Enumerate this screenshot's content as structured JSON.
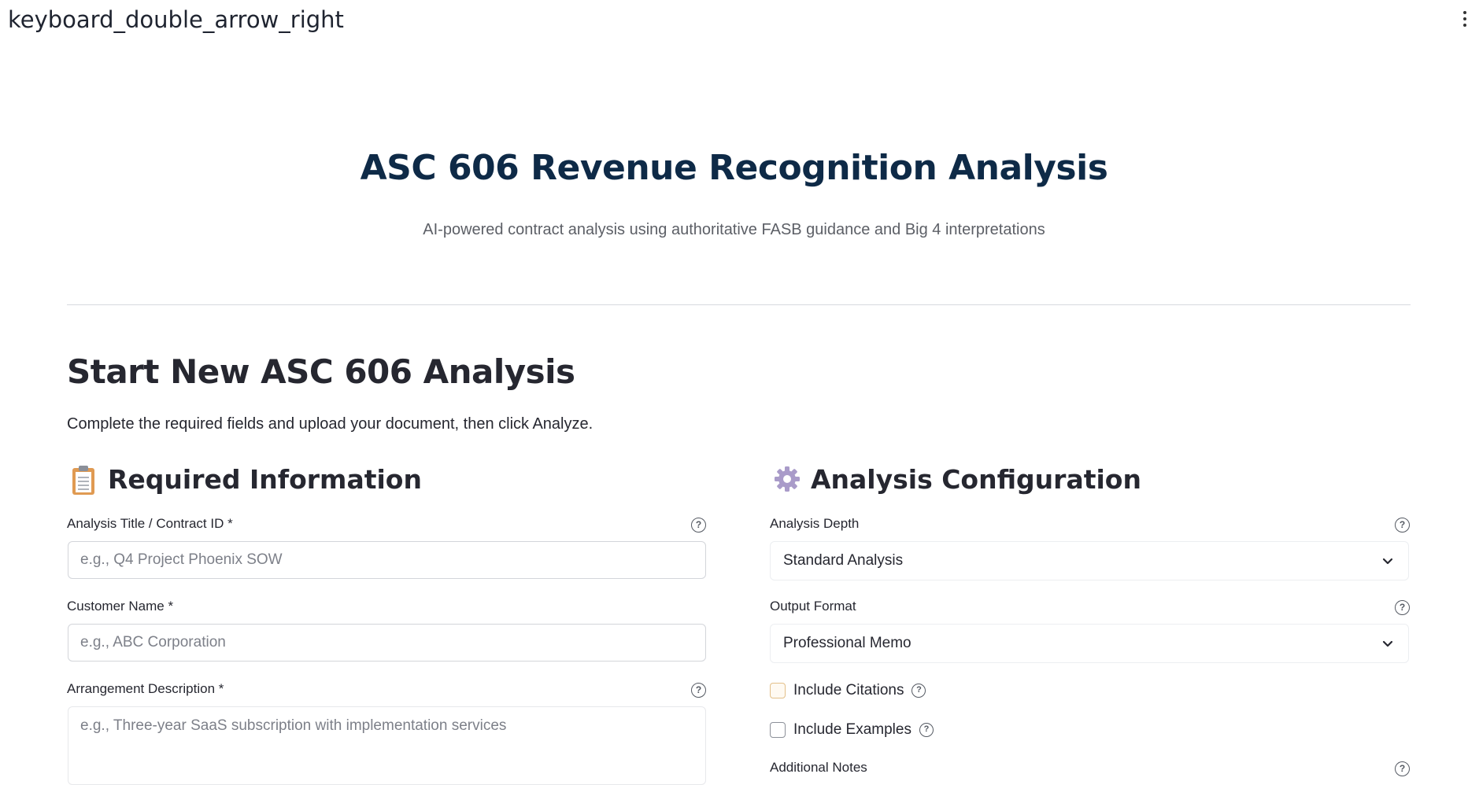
{
  "sidebar": {
    "toggle_label": "keyboard_double_arrow_right"
  },
  "header": {
    "title": "ASC 606 Revenue Recognition Analysis",
    "subtitle": "AI-powered contract analysis using authoritative FASB guidance and Big 4 interpretations"
  },
  "section": {
    "heading": "Start New ASC 606 Analysis",
    "description": "Complete the required fields and upload your document, then click Analyze."
  },
  "required_info": {
    "heading": "Required Information",
    "icon": "clipboard-icon",
    "fields": {
      "title": {
        "label": "Analysis Title / Contract ID *",
        "placeholder": "e.g., Q4 Project Phoenix SOW",
        "value": ""
      },
      "customer": {
        "label": "Customer Name *",
        "placeholder": "e.g., ABC Corporation",
        "value": ""
      },
      "arrangement": {
        "label": "Arrangement Description *",
        "placeholder": "e.g., Three-year SaaS subscription with implementation services",
        "value": ""
      }
    }
  },
  "analysis_config": {
    "heading": "Analysis Configuration",
    "icon": "gear-icon",
    "depth": {
      "label": "Analysis Depth",
      "selected": "Standard Analysis"
    },
    "format": {
      "label": "Output Format",
      "selected": "Professional Memo"
    },
    "include_citations": {
      "label": "Include Citations",
      "checked": false
    },
    "include_examples": {
      "label": "Include Examples",
      "checked": false
    },
    "notes": {
      "label": "Additional Notes"
    }
  },
  "help_glyph": "?"
}
